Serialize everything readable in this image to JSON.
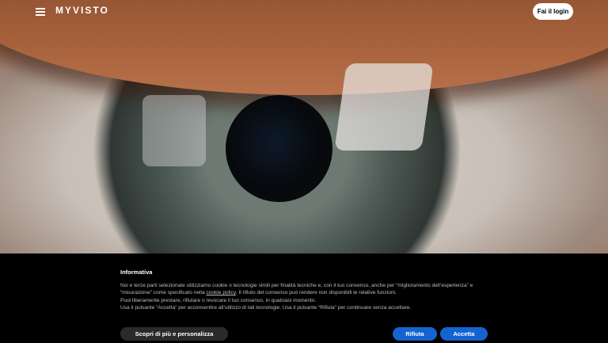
{
  "header": {
    "logo": "MYVISTO",
    "login_label": "Fai il login"
  },
  "hero": {
    "image": "eye-closeup-image"
  },
  "cookie_banner": {
    "title": "Informativa",
    "line1_pre": "Noi e terze parti selezionate utilizziamo cookie o tecnologie simili per finalità tecniche e, con il tuo consenso, anche per “miglioramento dell’esperienza” e “misurazione” come specificato nella ",
    "link_text": "cookie policy",
    "line1_post": ". Il rifiuto del consenso può rendere non disponibili le relative funzioni.",
    "line2": "Puoi liberamente prestare, rifiutare o revocare il tuo consenso, in qualsiasi momento.",
    "line3": "Usa il pulsante “Accetta” per acconsentire all’utilizzo di tali tecnologie. Usa il pulsante “Rifiuta” per continuare senza accettare.",
    "customize_label": "Scopri di più e personalizza",
    "reject_label": "Rifiuta",
    "accept_label": "Accetta"
  },
  "colors": {
    "background": "#000000",
    "primary_button": "#1463d1",
    "secondary_button": "#2a2a2a"
  }
}
